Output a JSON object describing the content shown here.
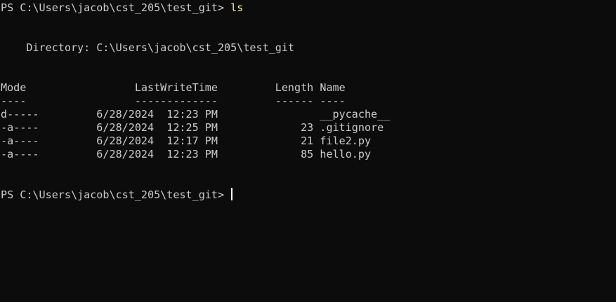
{
  "prompt_1": {
    "text": "PS C:\\Users\\jacob\\cst_205\\test_git> ",
    "command": "ls"
  },
  "directory_line": "    Directory: C:\\Users\\jacob\\cst_205\\test_git",
  "table": {
    "header": "Mode                 LastWriteTime         Length Name",
    "underline": "----                 -------------         ------ ----",
    "rows": [
      {
        "text": "d-----         6/28/2024  12:23 PM                __pycache__"
      },
      {
        "text": "-a----         6/28/2024  12:25 PM             23 .gitignore"
      },
      {
        "text": "-a----         6/28/2024  12:17 PM             21 file2.py"
      },
      {
        "text": "-a----         6/28/2024  12:23 PM             85 hello.py"
      }
    ]
  },
  "prompt_2": {
    "text": "PS C:\\Users\\jacob\\cst_205\\test_git> "
  },
  "colors": {
    "background": "#0c0c0c",
    "foreground": "#cccccc",
    "command": "#f9f1a5"
  }
}
